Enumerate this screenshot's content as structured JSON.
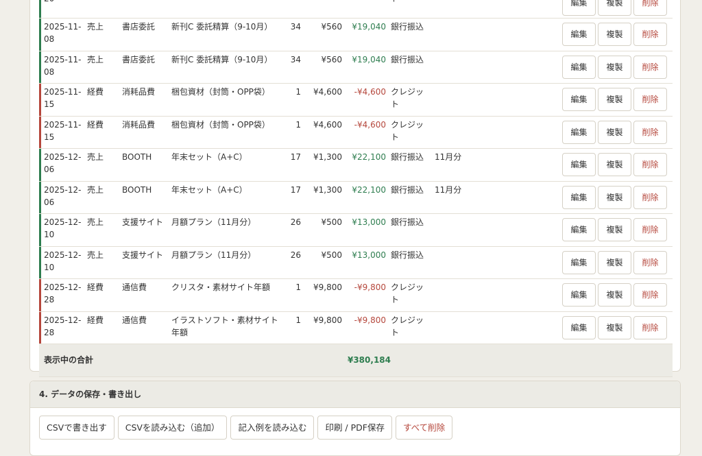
{
  "ledger": {
    "partial_row": {
      "date": "20",
      "method": "ト",
      "actions": [
        "編集",
        "複製",
        "削除"
      ]
    },
    "rows": [
      {
        "date": "2025-11-08",
        "type": "売上",
        "category": "書店委託",
        "item": "新刊C 委託精算（9-10月）",
        "qty": "34",
        "price": "¥560",
        "amount": "¥19,040",
        "method": "銀行振込",
        "memo": "",
        "kind": "income"
      },
      {
        "date": "2025-11-08",
        "type": "売上",
        "category": "書店委託",
        "item": "新刊C 委託精算（9-10月）",
        "qty": "34",
        "price": "¥560",
        "amount": "¥19,040",
        "method": "銀行振込",
        "memo": "",
        "kind": "income"
      },
      {
        "date": "2025-11-15",
        "type": "経費",
        "category": "消耗品費",
        "item": "梱包資材（封筒・OPP袋）",
        "qty": "1",
        "price": "¥4,600",
        "amount": "-¥4,600",
        "method": "クレジット",
        "memo": "",
        "kind": "expense"
      },
      {
        "date": "2025-11-15",
        "type": "経費",
        "category": "消耗品費",
        "item": "梱包資材（封筒・OPP袋）",
        "qty": "1",
        "price": "¥4,600",
        "amount": "-¥4,600",
        "method": "クレジット",
        "memo": "",
        "kind": "expense"
      },
      {
        "date": "2025-12-06",
        "type": "売上",
        "category": "BOOTH",
        "item": "年末セット（A+C）",
        "qty": "17",
        "price": "¥1,300",
        "amount": "¥22,100",
        "method": "銀行振込",
        "memo": "11月分",
        "kind": "income"
      },
      {
        "date": "2025-12-06",
        "type": "売上",
        "category": "BOOTH",
        "item": "年末セット（A+C）",
        "qty": "17",
        "price": "¥1,300",
        "amount": "¥22,100",
        "method": "銀行振込",
        "memo": "11月分",
        "kind": "income"
      },
      {
        "date": "2025-12-10",
        "type": "売上",
        "category": "支援サイト",
        "item": "月額プラン（11月分）",
        "qty": "26",
        "price": "¥500",
        "amount": "¥13,000",
        "method": "銀行振込",
        "memo": "",
        "kind": "income"
      },
      {
        "date": "2025-12-10",
        "type": "売上",
        "category": "支援サイト",
        "item": "月額プラン（11月分）",
        "qty": "26",
        "price": "¥500",
        "amount": "¥13,000",
        "method": "銀行振込",
        "memo": "",
        "kind": "income"
      },
      {
        "date": "2025-12-28",
        "type": "経費",
        "category": "通信費",
        "item": "クリスタ・素材サイト年額",
        "qty": "1",
        "price": "¥9,800",
        "amount": "-¥9,800",
        "method": "クレジット",
        "memo": "",
        "kind": "expense"
      },
      {
        "date": "2025-12-28",
        "type": "経費",
        "category": "通信費",
        "item": "イラストソフト・素材サイト年額",
        "qty": "1",
        "price": "¥9,800",
        "amount": "-¥9,800",
        "method": "クレジット",
        "memo": "",
        "kind": "expense"
      }
    ],
    "actions": {
      "edit": "編集",
      "duplicate": "複製",
      "delete": "削除"
    },
    "total_label": "表示中の合計",
    "total_amount": "¥380,184"
  },
  "export": {
    "title": "4. データの保存・書き出し",
    "buttons": {
      "csv_export": "CSVで書き出す",
      "csv_import": "CSVを読み込む（追加）",
      "load_sample": "記入例を読み込む",
      "print_pdf": "印刷 / PDF保存",
      "delete_all": "すべて削除"
    }
  },
  "colors": {
    "income": "#2e7d4f",
    "expense": "#b5473c"
  }
}
